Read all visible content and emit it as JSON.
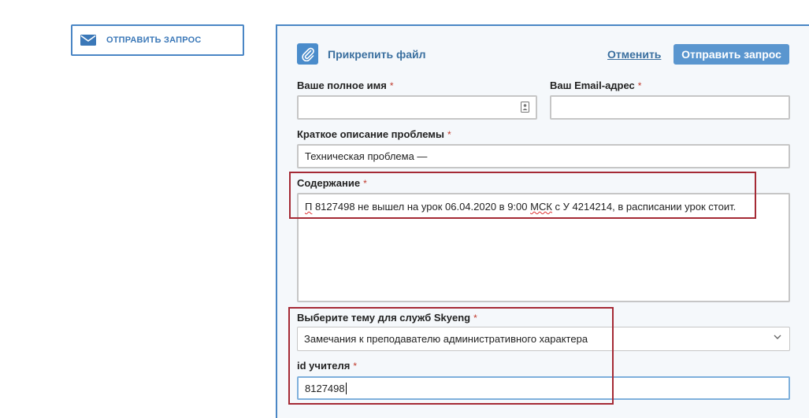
{
  "sidebar": {
    "send_request_label": "ОТПРАВИТЬ ЗАПРОС"
  },
  "toolbar": {
    "attach_label": "Прикрепить файл",
    "cancel_label": "Отменить",
    "submit_label": "Отправить запрос"
  },
  "form": {
    "required_mark": "*",
    "full_name": {
      "label": "Ваше полное имя",
      "value": ""
    },
    "email": {
      "label": "Ваш Email-адрес",
      "value": ""
    },
    "summary": {
      "label": "Краткое описание проблемы",
      "value": "Техническая проблема —"
    },
    "content": {
      "label": "Содержание",
      "value_parts": [
        "П",
        " 8127498 не вышел на урок 06.04.2020 в 9:00 ",
        "МСК",
        " с У 4214214, в расписании урок стоит."
      ]
    },
    "topic": {
      "label": "Выберите тему для служб Skyeng",
      "selected": "Замечания к преподавателю административного характера"
    },
    "teacher_id": {
      "label": "id учителя",
      "value": "8127498"
    }
  },
  "colors": {
    "accent": "#4a86c5",
    "button": "#5a96cf",
    "highlight": "#a52a35",
    "required": "#c0392b"
  },
  "icons": [
    "envelope-icon",
    "paperclip-icon",
    "autofill-icon",
    "chevron-down-icon"
  ]
}
